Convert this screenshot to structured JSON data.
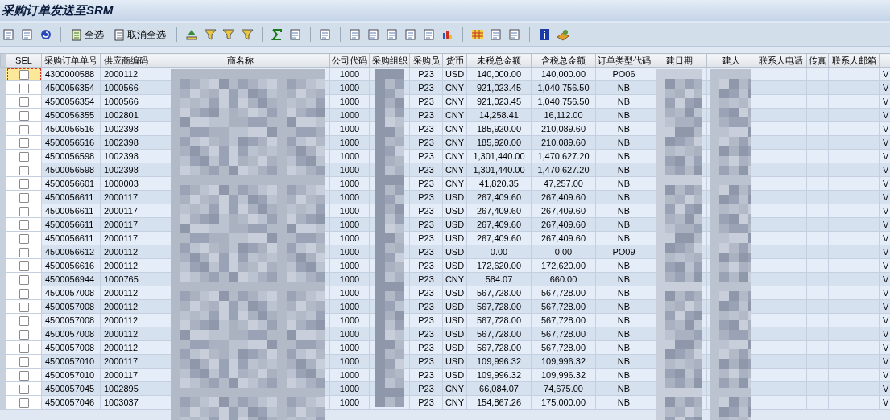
{
  "window": {
    "title": "采购订单发送至SRM"
  },
  "toolbar": {
    "buttons": [
      {
        "kind": "select",
        "label": "全选"
      },
      {
        "kind": "deselect",
        "label": "取消全选"
      }
    ]
  },
  "table": {
    "columns": [
      {
        "kind": "check",
        "label": "SEL"
      },
      {
        "kind": "text",
        "label": "采购订单单号"
      },
      {
        "kind": "text",
        "label": "供应商编码"
      },
      {
        "kind": "hidden",
        "label": "商名称"
      },
      {
        "kind": "text",
        "label": "公司代码"
      },
      {
        "kind": "hidden",
        "label": "采购组织"
      },
      {
        "kind": "text",
        "label": "采购员"
      },
      {
        "kind": "text",
        "label": "货币"
      },
      {
        "kind": "text",
        "label": "未税总金额"
      },
      {
        "kind": "text",
        "label": "含税总金额"
      },
      {
        "kind": "text",
        "label": "订单类型代码"
      },
      {
        "kind": "hidden",
        "label": "建日期"
      },
      {
        "kind": "hidden",
        "label": "建人"
      },
      {
        "kind": "text",
        "label": "联系人电话"
      },
      {
        "kind": "text",
        "label": "传真"
      },
      {
        "kind": "text",
        "label": "联系人邮箱"
      },
      {
        "kind": "text"
      }
    ],
    "rows": [
      {
        "focused": true,
        "checked": false,
        "cells": [
          null,
          "4300000588",
          "2000112",
          null,
          "1000",
          null,
          "P23",
          "USD",
          "140,000.00",
          "140,000.00",
          "PO06",
          null,
          null,
          null,
          null,
          null,
          "V"
        ]
      },
      {
        "focused": false,
        "checked": false,
        "cells": [
          null,
          "4500056354",
          "1000566",
          null,
          "1000",
          null,
          "P23",
          "CNY",
          "921,023.45",
          "1,040,756.50",
          "NB",
          null,
          null,
          null,
          null,
          null,
          "V"
        ]
      },
      {
        "focused": false,
        "checked": false,
        "cells": [
          null,
          "4500056354",
          "1000566",
          null,
          "1000",
          null,
          "P23",
          "CNY",
          "921,023.45",
          "1,040,756.50",
          "NB",
          null,
          null,
          null,
          null,
          null,
          "V"
        ]
      },
      {
        "focused": false,
        "checked": false,
        "cells": [
          null,
          "4500056355",
          "1002801",
          null,
          "1000",
          null,
          "P23",
          "CNY",
          "14,258.41",
          "16,112.00",
          "NB",
          null,
          null,
          null,
          null,
          null,
          "V"
        ]
      },
      {
        "focused": false,
        "checked": false,
        "cells": [
          null,
          "4500056516",
          "1002398",
          null,
          "1000",
          null,
          "P23",
          "CNY",
          "185,920.00",
          "210,089.60",
          "NB",
          null,
          null,
          null,
          null,
          null,
          "V"
        ]
      },
      {
        "focused": false,
        "checked": false,
        "cells": [
          null,
          "4500056516",
          "1002398",
          null,
          "1000",
          null,
          "P23",
          "CNY",
          "185,920.00",
          "210,089.60",
          "NB",
          null,
          null,
          null,
          null,
          null,
          "V"
        ]
      },
      {
        "focused": false,
        "checked": false,
        "cells": [
          null,
          "4500056598",
          "1002398",
          null,
          "1000",
          null,
          "P23",
          "CNY",
          "1,301,440.00",
          "1,470,627.20",
          "NB",
          null,
          null,
          null,
          null,
          null,
          "V"
        ]
      },
      {
        "focused": false,
        "checked": false,
        "cells": [
          null,
          "4500056598",
          "1002398",
          null,
          "1000",
          null,
          "P23",
          "CNY",
          "1,301,440.00",
          "1,470,627.20",
          "NB",
          null,
          null,
          null,
          null,
          null,
          "V"
        ]
      },
      {
        "focused": false,
        "checked": false,
        "cells": [
          null,
          "4500056601",
          "1000003",
          null,
          "1000",
          null,
          "P23",
          "CNY",
          "41,820.35",
          "47,257.00",
          "NB",
          null,
          null,
          null,
          null,
          null,
          "V"
        ]
      },
      {
        "focused": false,
        "checked": false,
        "cells": [
          null,
          "4500056611",
          "2000117",
          null,
          "1000",
          null,
          "P23",
          "USD",
          "267,409.60",
          "267,409.60",
          "NB",
          null,
          null,
          null,
          null,
          null,
          "V"
        ]
      },
      {
        "focused": false,
        "checked": false,
        "cells": [
          null,
          "4500056611",
          "2000117",
          null,
          "1000",
          null,
          "P23",
          "USD",
          "267,409.60",
          "267,409.60",
          "NB",
          null,
          null,
          null,
          null,
          null,
          "V"
        ]
      },
      {
        "focused": false,
        "checked": false,
        "cells": [
          null,
          "4500056611",
          "2000117",
          null,
          "1000",
          null,
          "P23",
          "USD",
          "267,409.60",
          "267,409.60",
          "NB",
          null,
          null,
          null,
          null,
          null,
          "V"
        ]
      },
      {
        "focused": false,
        "checked": false,
        "cells": [
          null,
          "4500056611",
          "2000117",
          null,
          "1000",
          null,
          "P23",
          "USD",
          "267,409.60",
          "267,409.60",
          "NB",
          null,
          null,
          null,
          null,
          null,
          "V"
        ]
      },
      {
        "focused": false,
        "checked": false,
        "cells": [
          null,
          "4500056612",
          "2000112",
          null,
          "1000",
          null,
          "P23",
          "USD",
          "0.00",
          "0.00",
          "PO09",
          null,
          null,
          null,
          null,
          null,
          "V"
        ]
      },
      {
        "focused": false,
        "checked": false,
        "cells": [
          null,
          "4500056616",
          "2000112",
          null,
          "1000",
          null,
          "P23",
          "USD",
          "172,620.00",
          "172,620.00",
          "NB",
          null,
          null,
          null,
          null,
          null,
          "V"
        ]
      },
      {
        "focused": false,
        "checked": false,
        "cells": [
          null,
          "4500056944",
          "1000765",
          null,
          "1000",
          null,
          "P23",
          "CNY",
          "584.07",
          "660.00",
          "NB",
          null,
          null,
          null,
          null,
          null,
          "V"
        ]
      },
      {
        "focused": false,
        "checked": false,
        "cells": [
          null,
          "4500057008",
          "2000112",
          null,
          "1000",
          null,
          "P23",
          "USD",
          "567,728.00",
          "567,728.00",
          "NB",
          null,
          null,
          null,
          null,
          null,
          "V"
        ]
      },
      {
        "focused": false,
        "checked": false,
        "cells": [
          null,
          "4500057008",
          "2000112",
          null,
          "1000",
          null,
          "P23",
          "USD",
          "567,728.00",
          "567,728.00",
          "NB",
          null,
          null,
          null,
          null,
          null,
          "V"
        ]
      },
      {
        "focused": false,
        "checked": false,
        "cells": [
          null,
          "4500057008",
          "2000112",
          null,
          "1000",
          null,
          "P23",
          "USD",
          "567,728.00",
          "567,728.00",
          "NB",
          null,
          null,
          null,
          null,
          null,
          "V"
        ]
      },
      {
        "focused": false,
        "checked": false,
        "cells": [
          null,
          "4500057008",
          "2000112",
          null,
          "1000",
          null,
          "P23",
          "USD",
          "567,728.00",
          "567,728.00",
          "NB",
          null,
          null,
          null,
          null,
          null,
          "V"
        ]
      },
      {
        "focused": false,
        "checked": false,
        "cells": [
          null,
          "4500057008",
          "2000112",
          null,
          "1000",
          null,
          "P23",
          "USD",
          "567,728.00",
          "567,728.00",
          "NB",
          null,
          null,
          null,
          null,
          null,
          "V"
        ]
      },
      {
        "focused": false,
        "checked": false,
        "cells": [
          null,
          "4500057010",
          "2000117",
          null,
          "1000",
          null,
          "P23",
          "USD",
          "109,996.32",
          "109,996.32",
          "NB",
          null,
          null,
          null,
          null,
          null,
          "V"
        ]
      },
      {
        "focused": false,
        "checked": false,
        "cells": [
          null,
          "4500057010",
          "2000117",
          null,
          "1000",
          null,
          "P23",
          "USD",
          "109,996.32",
          "109,996.32",
          "NB",
          null,
          null,
          null,
          null,
          null,
          "V"
        ]
      },
      {
        "focused": false,
        "checked": false,
        "cells": [
          null,
          "4500057045",
          "1002895",
          null,
          "1000",
          null,
          "P23",
          "CNY",
          "66,084.07",
          "74,675.00",
          "NB",
          null,
          null,
          null,
          null,
          null,
          "V"
        ]
      },
      {
        "focused": false,
        "checked": false,
        "cells": [
          null,
          "4500057046",
          "1003037",
          null,
          "1000",
          null,
          "P23",
          "CNY",
          "154,867.26",
          "175,000.00",
          "NB",
          null,
          null,
          null,
          null,
          null,
          "V"
        ]
      }
    ]
  }
}
